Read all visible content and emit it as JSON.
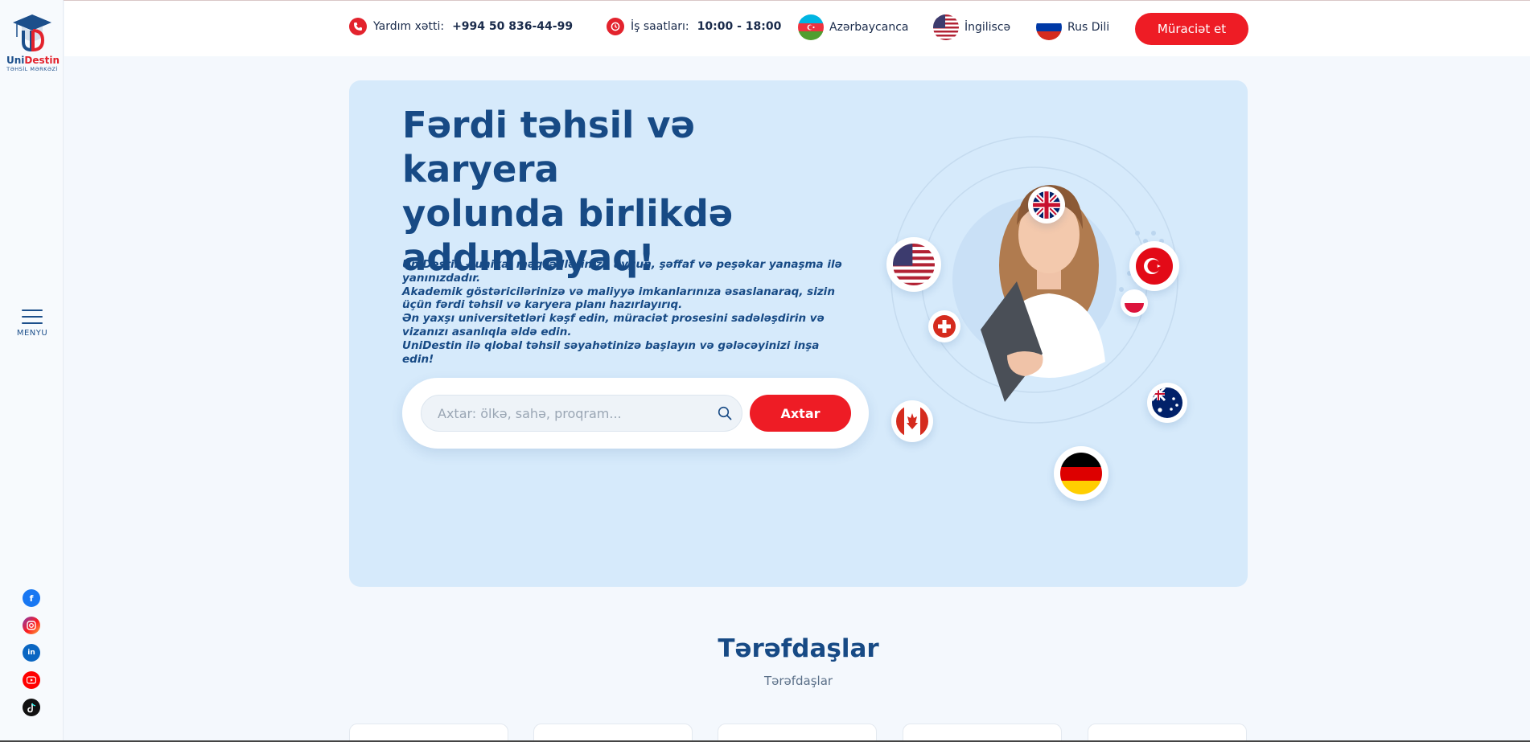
{
  "brand": {
    "name_part1": "Uni",
    "name_part2": "Destin",
    "tagline": "TƏHSİL MƏRKƏZİ"
  },
  "sidebar": {
    "menu_label": "MENYU",
    "socials": [
      "facebook-icon",
      "instagram-icon",
      "linkedin-icon",
      "youtube-icon",
      "tiktok-icon"
    ]
  },
  "header": {
    "hotline_label": "Yardım xətti:",
    "hotline_value": "+994 50 836-44-99",
    "hours_label": "İş saatları:",
    "hours_value": "10:00 - 18:00",
    "languages": [
      {
        "label": "Azərbaycanca",
        "icon": "azerbaijan-flag-icon"
      },
      {
        "label": "İngiliscə",
        "icon": "usa-flag-icon"
      },
      {
        "label": "Rus Dili",
        "icon": "russia-flag-icon"
      }
    ],
    "apply_button": "Müraciət et"
  },
  "hero": {
    "title_line1": "Fərdi təhsil və karyera",
    "title_line2": "yolunda birlikdə",
    "title_line3": "addımlayaq!",
    "paragraphs": [
      "UniDestin – unikal məqsədlərinizə uyğun, şəffaf və peşəkar yanaşma ilə yanınızdadır.",
      "Akademik göstəricilərinizə və maliyyə imkanlarınıza əsaslanaraq, sizin üçün fərdi təhsil və karyera planı hazırlayırıq.",
      "Ən yaxşı universitetləri kəşf edin, müraciət prosesini sadələşdirin və vizanızı asanlıqla əldə edin.",
      "UniDestin ilə qlobal təhsil səyahətinizə başlayın və gələcəyinizi inşa edin!"
    ],
    "search_placeholder": "Axtar: ölkə, sahə, proqram...",
    "search_value": "",
    "search_button": "Axtar",
    "flags": [
      "uk-flag-icon",
      "usa-flag-icon",
      "turkey-flag-icon",
      "poland-flag-icon",
      "switzerland-flag-icon",
      "canada-flag-icon",
      "australia-flag-icon",
      "germany-flag-icon"
    ]
  },
  "partners": {
    "title": "Tərəfdaşlar",
    "subtitle": "Tərəfdaşlar"
  },
  "colors": {
    "brand_blue": "#174a85",
    "accent_red": "#ee1c25",
    "hero_bg": "#d6eafb"
  }
}
